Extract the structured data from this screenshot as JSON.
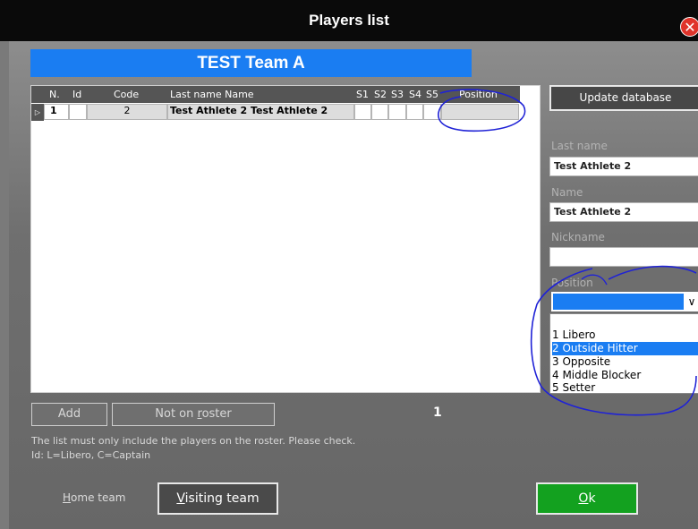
{
  "window": {
    "title": "Players list",
    "close_icon": "close-icon"
  },
  "team_header": "TEST Team A",
  "table": {
    "columns": [
      "N.",
      "Id",
      "Code",
      "Last name Name",
      "S1",
      "S2",
      "S3",
      "S4",
      "S5",
      "Position"
    ],
    "rows": [
      {
        "marker": "▷",
        "n": "1",
        "id": "",
        "code": "2",
        "name": "Test Athlete 2 Test Athlete 2",
        "s1": "",
        "s2": "",
        "s3": "",
        "s4": "",
        "s5": "",
        "position": ""
      }
    ]
  },
  "buttons": {
    "update_database": "Update database",
    "add": "Add",
    "not_on_roster_pre": "Not on ",
    "not_on_roster_u": "r",
    "not_on_roster_post": "oster",
    "home_team_pre": "",
    "home_team_u": "H",
    "home_team_post": "ome team",
    "visiting_team_pre": "",
    "visiting_team_u": "V",
    "visiting_team_post": "isiting team",
    "ok_pre": "",
    "ok_u": "O",
    "ok_post": "k"
  },
  "form": {
    "last_name_label": "Last name",
    "last_name_value": "Test Athlete 2",
    "name_label": "Name",
    "name_value": "Test Athlete 2",
    "nickname_label": "Nickname",
    "nickname_value": "",
    "position_label": "Position",
    "position_options": [
      "1 Libero",
      "2 Outside Hitter",
      "3 Opposite",
      "4 Middle Blocker",
      "5 Setter"
    ],
    "highlighted_option": "2 Outside Hitter"
  },
  "count": "1",
  "notes": {
    "line1": "The list must only include the players on the roster. Please check.",
    "line2": "Id: L=Libero, C=Captain"
  },
  "colors": {
    "accent_blue": "#1a7df2",
    "ok_green": "#13a11f",
    "annotation_ink": "#1f22d6"
  }
}
